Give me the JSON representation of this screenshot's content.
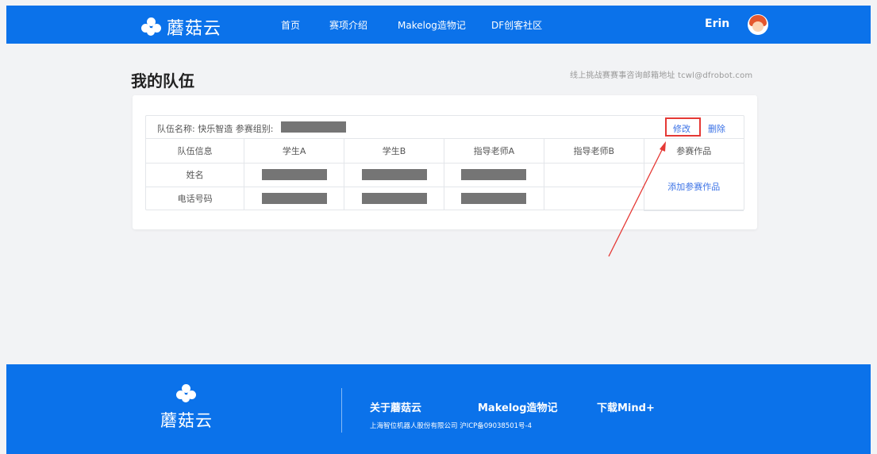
{
  "nav": {
    "logo_text": "蘑菇云",
    "items": [
      "首页",
      "赛项介绍",
      "Makelog造物记",
      "DF创客社区"
    ],
    "user_name": "Erin"
  },
  "page": {
    "title": "我的队伍",
    "contact": "线上挑战赛赛事咨询邮箱地址 tcwl@dfrobot.com"
  },
  "team": {
    "header_label": "队伍名称: 快乐智造 参赛组别:",
    "edit_label": "修改",
    "delete_label": "删除",
    "columns": [
      "队伍信息",
      "学生A",
      "学生B",
      "指导老师A",
      "指导老师B",
      "参赛作品"
    ],
    "rows": [
      {
        "label": "姓名"
      },
      {
        "label": "电话号码"
      }
    ],
    "add_work_label": "添加参赛作品"
  },
  "footer": {
    "logo_text": "蘑菇云",
    "links": [
      "关于蘑菇云",
      "Makelog造物记",
      "下载Mind+"
    ],
    "copyright": "上海智位机器人股份有限公司 沪ICP备09038501号-4"
  },
  "colors": {
    "brand_blue": "#0b72ea",
    "link_blue": "#3b72e6",
    "highlight_red": "#e53935",
    "redaction_gray": "#757575"
  }
}
